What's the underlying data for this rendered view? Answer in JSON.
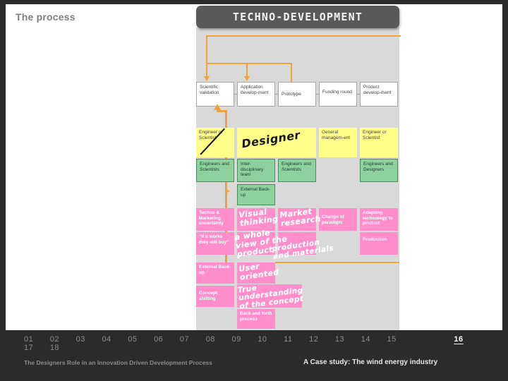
{
  "slide": {
    "title": "The process",
    "banner": "TECHNO-DEVELOPMENT"
  },
  "diagram": {
    "stages": [
      {
        "label": "Scientific validation"
      },
      {
        "label": "Application develop-ment"
      },
      {
        "label": "Prototype"
      },
      {
        "label": "Funding round"
      },
      {
        "label": "Product develop-ment"
      }
    ],
    "role_row": [
      {
        "label": "Engineer or Scientist",
        "struck": true
      },
      {
        "label": ""
      },
      {
        "label": ""
      },
      {
        "label": "General managem-ent",
        "struck": false
      },
      {
        "label": "Engineer or Scientist",
        "struck": false
      }
    ],
    "team_row": [
      {
        "label": "Engineers and Scientists"
      },
      {
        "label": "Inter-disciplinary team"
      },
      {
        "label": "Engineers and Scientists"
      },
      {
        "label": ""
      },
      {
        "label": "Engineers and Designers"
      }
    ],
    "team_row_extra": {
      "label": "External Back-up"
    },
    "issue_row_1": [
      {
        "label": "Techno & Marketing uncertainty"
      },
      {
        "label": ""
      },
      {
        "label": ""
      },
      {
        "label": "Change of paradigm"
      },
      {
        "label": "Adapting technology to product"
      }
    ],
    "issue_row_2": [
      {
        "label": "\"If it works they will buy\""
      },
      {
        "label": ""
      },
      {
        "label": ""
      },
      {
        "label": ""
      },
      {
        "label": "Production"
      }
    ],
    "issue_row_3": [
      {
        "label": "External Back-up"
      }
    ],
    "issue_row_4": [
      {
        "label": "Concept shifting"
      }
    ],
    "handwritten": [
      {
        "text": "Designer",
        "name": "designer"
      },
      {
        "text": "Visual\nthinking",
        "name": "visual-thinking"
      },
      {
        "text": "Market\nresearch",
        "name": "market-research"
      },
      {
        "text": "a whole\nview of the\nproduct",
        "name": "whole-view-of-the-product"
      },
      {
        "text": "production\nand materials",
        "name": "production-and-materials"
      },
      {
        "text": "User\noriented",
        "name": "user-oriented"
      },
      {
        "text": "True\nunderstanding\nof the concept",
        "name": "true-understanding-of-the-concept"
      },
      {
        "text": "Back and forth process",
        "name": "back-and-forth-process"
      }
    ]
  },
  "footer": {
    "pages": [
      "01",
      "02",
      "03",
      "04",
      "05",
      "06",
      "07",
      "08",
      "09",
      "10",
      "11",
      "12",
      "13",
      "14",
      "15",
      "16",
      "17",
      "18"
    ],
    "current_page": "16",
    "subtitle_left": "The Designers Role in an Innovation Driven Development Process",
    "subtitle_right": "A Case study: The wind energy industry"
  },
  "colors": {
    "accent_orange": "#f0a33c",
    "banner_bg": "#595959",
    "panel_bg": "#d9d9d9",
    "yellow": "#ffff8a",
    "green": "#8fd19e",
    "pink": "#ff8ecb",
    "footer_bg": "#2b2b2b"
  }
}
